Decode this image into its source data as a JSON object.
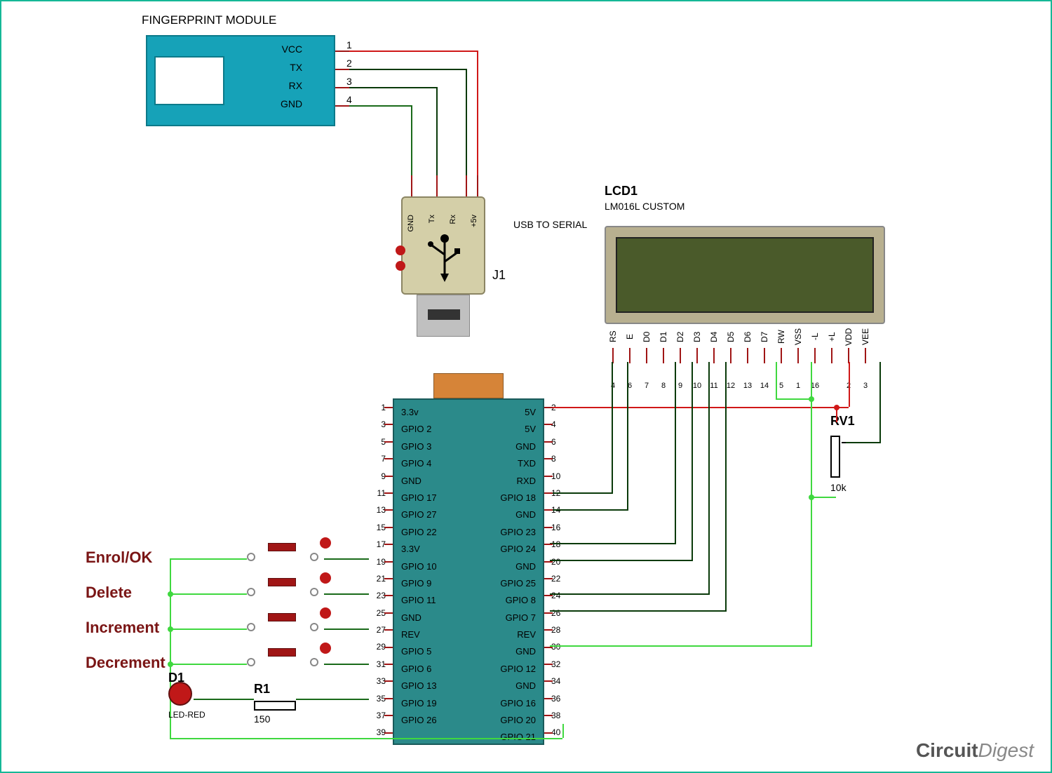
{
  "title_fingerprint": "FINGERPRINT MODULE",
  "fingerprint": {
    "pins": [
      "VCC",
      "TX",
      "RX",
      "GND"
    ],
    "pin_nums": [
      "1",
      "2",
      "3",
      "4"
    ]
  },
  "usb": {
    "ref": "J1",
    "desc": "USB TO SERIAL",
    "pins": [
      "GND",
      "Tx",
      "Rx",
      "+5v"
    ]
  },
  "lcd": {
    "ref": "LCD1",
    "part": "LM016L CUSTOM",
    "pins": [
      "RS",
      "E",
      "D0",
      "D1",
      "D2",
      "D3",
      "D4",
      "D5",
      "D6",
      "D7",
      "RW",
      "VSS",
      "-L",
      "+L",
      "VDD",
      "VEE"
    ],
    "pin_nums": [
      "4",
      "6",
      "7",
      "8",
      "9",
      "10",
      "11",
      "12",
      "13",
      "14",
      "5",
      "1",
      "16",
      "",
      "2",
      "3"
    ]
  },
  "rpi": {
    "left_pins": [
      "3.3v",
      "GPIO 2",
      "GPIO 3",
      "GPIO 4",
      "GND",
      "GPIO 17",
      "GPIO 27",
      "GPIO 22",
      "3.3V",
      "GPIO 10",
      "GPIO 9",
      "GPIO 11",
      "GND",
      "REV",
      "GPIO 5",
      "GPIO 6",
      "GPIO 13",
      "GPIO 19",
      "GPIO 26",
      ""
    ],
    "right_pins": [
      "5V",
      "5V",
      "GND",
      "TXD",
      "RXD",
      "GPIO 18",
      "GND",
      "GPIO 23",
      "GPIO 24",
      "GND",
      "GPIO 25",
      "GPIO 8",
      "GPIO 7",
      "REV",
      "GND",
      "GPIO 12",
      "GND",
      "GPIO 16",
      "GPIO 20",
      "GPIO 21"
    ],
    "left_nums": [
      "1",
      "3",
      "5",
      "7",
      "9",
      "11",
      "13",
      "15",
      "17",
      "19",
      "21",
      "23",
      "25",
      "27",
      "29",
      "31",
      "33",
      "35",
      "37",
      "39"
    ],
    "right_nums": [
      "2",
      "4",
      "6",
      "8",
      "10",
      "12",
      "14",
      "16",
      "18",
      "20",
      "22",
      "24",
      "26",
      "28",
      "30",
      "32",
      "34",
      "36",
      "38",
      "40"
    ]
  },
  "buttons": {
    "labels": [
      "Enrol/OK",
      "Delete",
      "Increment",
      "Decrement"
    ]
  },
  "d1": {
    "ref": "D1",
    "part": "LED-RED"
  },
  "r1": {
    "ref": "R1",
    "val": "150"
  },
  "rv1": {
    "ref": "RV1",
    "val": "10k"
  },
  "watermark": {
    "a": "Circuit",
    "b": "Digest"
  }
}
